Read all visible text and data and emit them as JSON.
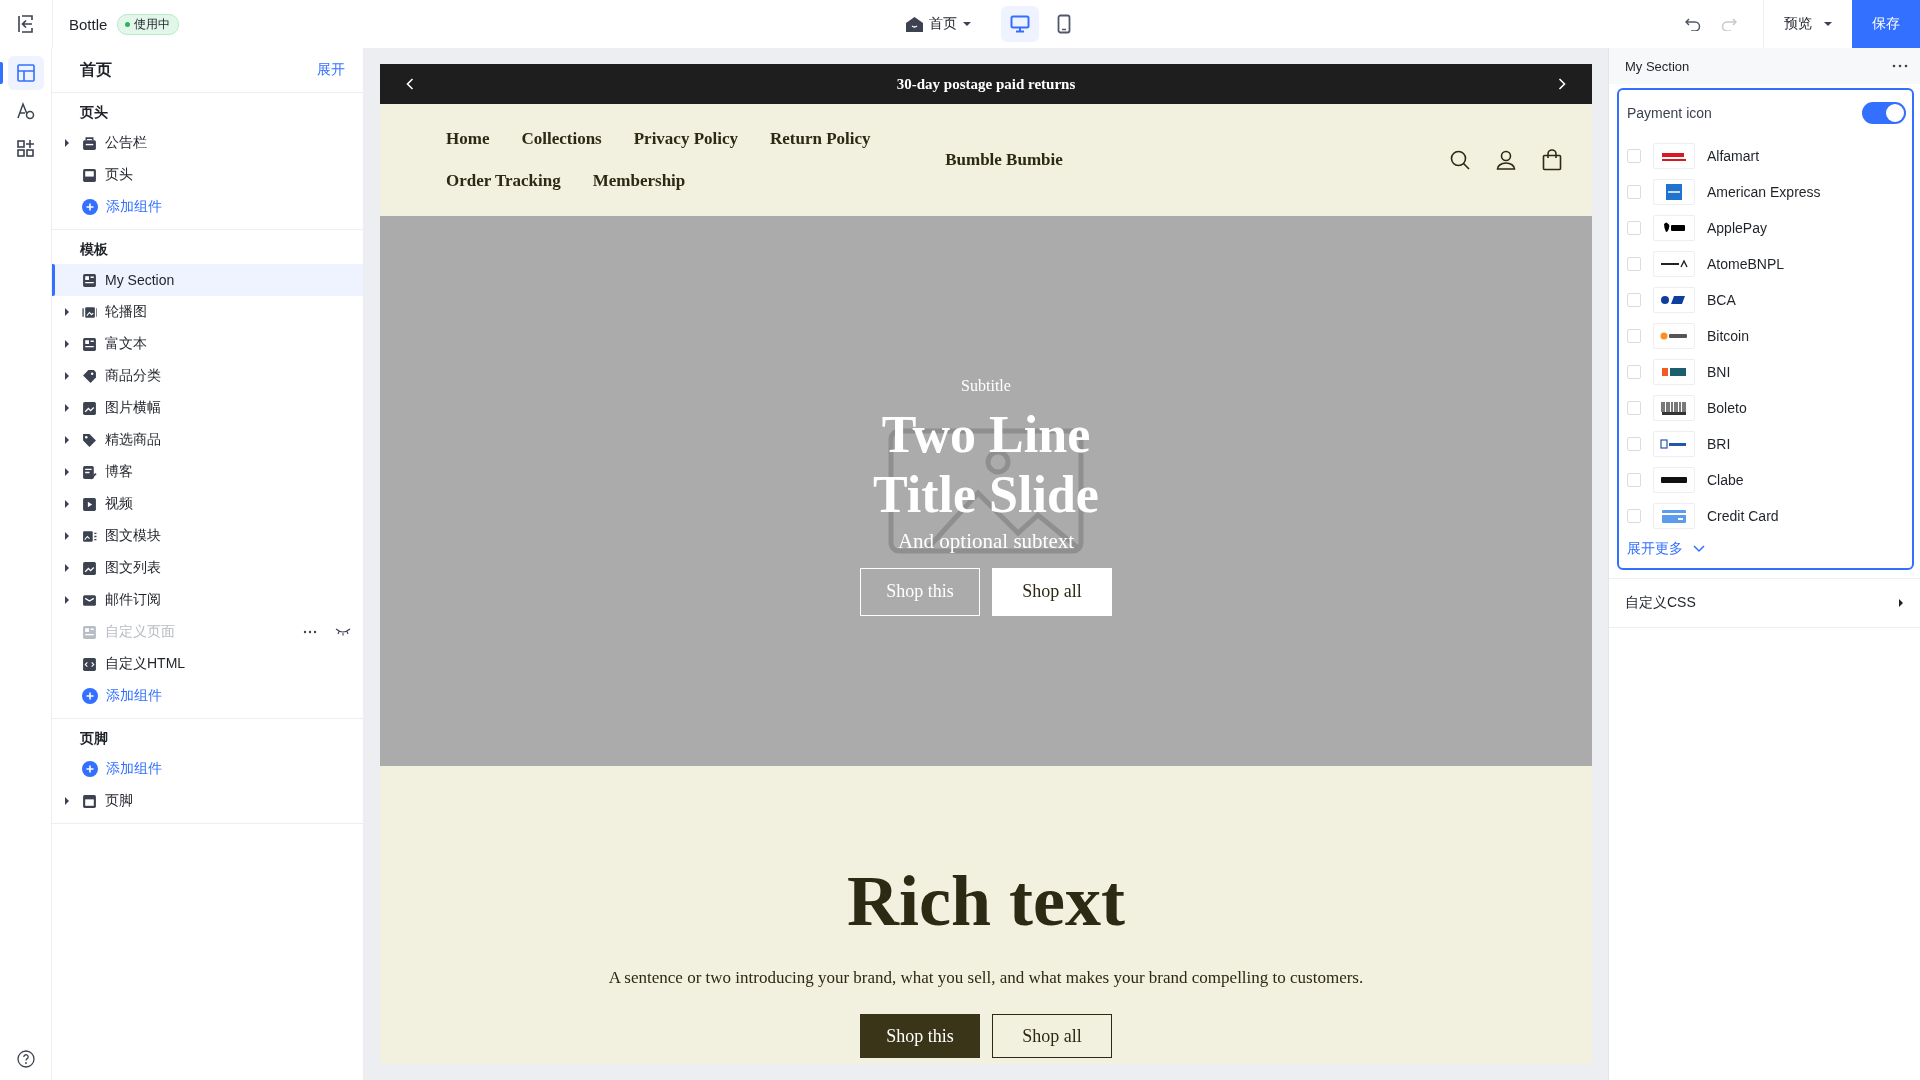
{
  "topbar": {
    "theme_name": "Bottle",
    "status_badge": "使用中",
    "page_selector": "首页",
    "devices": [
      {
        "kind": "desktop",
        "selected": true
      },
      {
        "kind": "mobile",
        "selected": false
      }
    ],
    "redo": {
      "disabled": true
    },
    "preview_label": "预览",
    "save_label": "保存"
  },
  "rail": {
    "items": [
      {
        "kind": "layout",
        "selected": true
      },
      {
        "kind": "theme",
        "selected": false
      },
      {
        "kind": "apps",
        "selected": false
      }
    ]
  },
  "tree": {
    "title": "首页",
    "expand_label": "展开",
    "groups": [
      {
        "title": "页头",
        "items": [
          {
            "kind": "component",
            "label": "公告栏",
            "expandable": true,
            "selected": false,
            "disabled": false
          },
          {
            "kind": "component",
            "label": "页头",
            "expandable": false,
            "selected": false,
            "disabled": false
          },
          {
            "kind": "add",
            "label": "添加组件"
          }
        ]
      },
      {
        "title": "模板",
        "items": [
          {
            "kind": "component",
            "label": "My Section",
            "expandable": false,
            "selected": true,
            "disabled": false
          },
          {
            "kind": "component",
            "label": "轮播图",
            "expandable": true,
            "selected": false,
            "disabled": false
          },
          {
            "kind": "component",
            "label": "富文本",
            "expandable": true,
            "selected": false,
            "disabled": false
          },
          {
            "kind": "component",
            "label": "商品分类",
            "expandable": true,
            "selected": false,
            "disabled": false
          },
          {
            "kind": "component",
            "label": "图片横幅",
            "expandable": true,
            "selected": false,
            "disabled": false
          },
          {
            "kind": "component",
            "label": "精选商品",
            "expandable": true,
            "selected": false,
            "disabled": false
          },
          {
            "kind": "component",
            "label": "博客",
            "expandable": true,
            "selected": false,
            "disabled": false
          },
          {
            "kind": "component",
            "label": "视频",
            "expandable": true,
            "selected": false,
            "disabled": false
          },
          {
            "kind": "component",
            "label": "图文模块",
            "expandable": true,
            "selected": false,
            "disabled": false
          },
          {
            "kind": "component",
            "label": "图文列表",
            "expandable": true,
            "selected": false,
            "disabled": false
          },
          {
            "kind": "component",
            "label": "邮件订阅",
            "expandable": true,
            "selected": false,
            "disabled": false
          },
          {
            "kind": "component",
            "label": "自定义页面",
            "expandable": false,
            "selected": false,
            "disabled": true
          },
          {
            "kind": "component",
            "label": "自定义HTML",
            "expandable": false,
            "selected": false,
            "disabled": false
          },
          {
            "kind": "add",
            "label": "添加组件"
          }
        ]
      },
      {
        "title": "页脚",
        "items": [
          {
            "kind": "add",
            "label": "添加组件"
          },
          {
            "kind": "component",
            "label": "页脚",
            "expandable": true,
            "selected": false,
            "disabled": false
          }
        ]
      }
    ]
  },
  "preview": {
    "announcement": "30-day postage paid returns",
    "nav": [
      "Home",
      "Collections",
      "Privacy Policy",
      "Return Policy",
      "Order Tracking",
      "Membership"
    ],
    "brand": "Bumble Bumbie",
    "hero": {
      "subtitle": "Subtitle",
      "title": "Two Line Title Slide",
      "subtext": "And optional subtext",
      "buttons": [
        {
          "label": "Shop this",
          "kind": "outline"
        },
        {
          "label": "Shop all",
          "kind": "solid"
        }
      ]
    },
    "rich_text": {
      "title": "Rich text",
      "body": "A sentence or two introducing your brand, what you sell, and what makes your brand compelling to customers.",
      "buttons": [
        {
          "label": "Shop this",
          "kind": "solid"
        },
        {
          "label": "Shop all",
          "kind": "outline"
        }
      ]
    }
  },
  "settings": {
    "title": "My Section",
    "payment": {
      "label": "Payment icon",
      "on": true,
      "more_label": "展开更多",
      "methods": [
        {
          "name": "Alfamart",
          "color": "#d71920",
          "checked": false
        },
        {
          "name": "American Express",
          "color": "#1f72cd",
          "checked": false
        },
        {
          "name": "ApplePay",
          "color": "#000000",
          "checked": false
        },
        {
          "name": "AtomeBNPL",
          "color": "#222222",
          "checked": false
        },
        {
          "name": "BCA",
          "color": "#0f3f9e",
          "checked": false
        },
        {
          "name": "Bitcoin",
          "color": "#f7931a",
          "checked": false
        },
        {
          "name": "BNI",
          "color": "#f15a23",
          "checked": false
        },
        {
          "name": "Boleto",
          "color": "#333333",
          "checked": false
        },
        {
          "name": "BRI",
          "color": "#2557a7",
          "checked": false
        },
        {
          "name": "Clabe",
          "color": "#111111",
          "checked": false
        },
        {
          "name": "Credit Card",
          "color": "#5b9bf0",
          "checked": false
        }
      ]
    },
    "custom_css": "自定义CSS"
  }
}
